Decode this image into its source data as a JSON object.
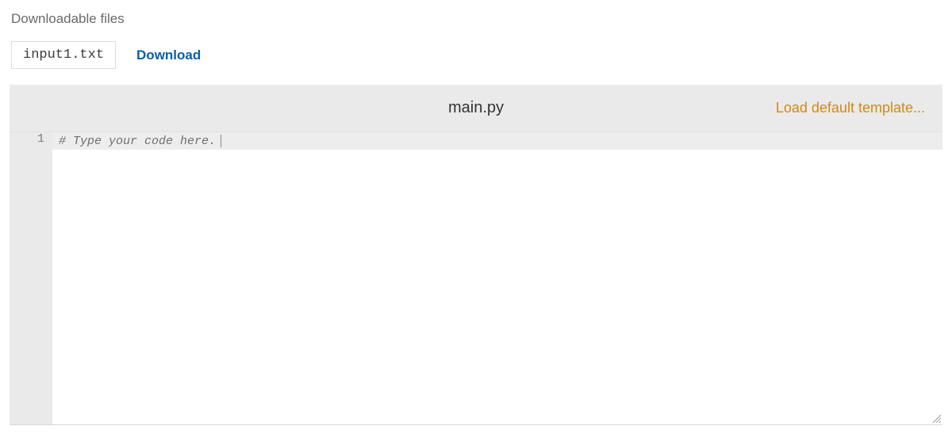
{
  "downloads": {
    "title": "Downloadable files",
    "items": [
      {
        "filename": "input1.txt",
        "action_label": "Download"
      }
    ]
  },
  "editor": {
    "filename": "main.py",
    "load_template_label": "Load default template...",
    "lines": [
      {
        "number": "1",
        "text": "# Type your code here."
      }
    ]
  }
}
